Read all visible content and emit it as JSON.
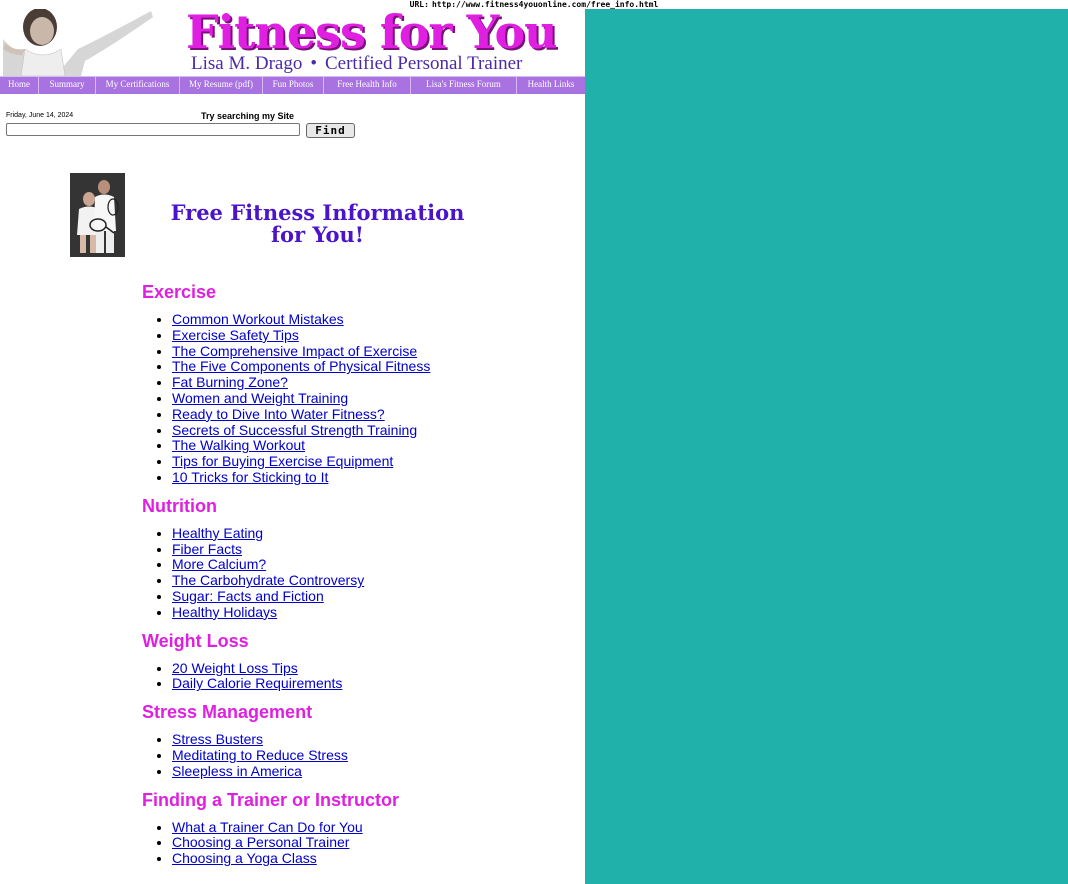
{
  "browser": {
    "url_label": "URL:",
    "url": "http://www.fitness4youonline.com/free_info.html"
  },
  "header": {
    "title": "Fitness for You",
    "subtitle_name": "Lisa M. Drago",
    "subtitle_separator": "•",
    "subtitle_role": "Certified Personal Trainer"
  },
  "nav": {
    "items": [
      {
        "label": "Home"
      },
      {
        "label": "Summary"
      },
      {
        "label": "My Certifications"
      },
      {
        "label": "My Resume (pdf)"
      },
      {
        "label": "Fun Photos"
      },
      {
        "label": "Free Health Info"
      },
      {
        "label": "Lisa's Fitness Forum"
      },
      {
        "label": "Health Links"
      }
    ]
  },
  "search": {
    "date": "Friday, June 14, 2024",
    "label": "Try searching my Site",
    "value": "",
    "button_label": "Find"
  },
  "page": {
    "heading_line1": "Free Fitness Information",
    "heading_line2": "for You!"
  },
  "sections": [
    {
      "title": "Exercise",
      "links": [
        "Common Workout Mistakes",
        "Exercise Safety Tips",
        "The Comprehensive Impact of Exercise",
        "The Five Components of Physical Fitness",
        "Fat Burning Zone?",
        "Women and Weight Training",
        "Ready to Dive Into Water Fitness?",
        "Secrets of Successful Strength Training",
        "The Walking Workout",
        "Tips for Buying Exercise Equipment",
        "10 Tricks for Sticking to It"
      ]
    },
    {
      "title": "Nutrition",
      "links": [
        "Healthy Eating",
        "Fiber Facts",
        "More Calcium?",
        "The Carbohydrate Controversy",
        "Sugar: Facts and Fiction",
        "Healthy Holidays"
      ]
    },
    {
      "title": "Weight Loss",
      "links": [
        "20 Weight Loss Tips",
        "Daily Calorie Requirements"
      ]
    },
    {
      "title": "Stress Management",
      "links": [
        "Stress Busters",
        "Meditating to Reduce Stress",
        "Sleepless in America"
      ]
    },
    {
      "title": "Finding a Trainer or Instructor",
      "links": [
        "What a Trainer Can Do for You",
        "Choosing a Personal Trainer",
        "Choosing a Yoga Class"
      ]
    }
  ],
  "colors": {
    "page_background": "#20b2aa",
    "section_title": "#e020e0",
    "nav_background": "#a872e0",
    "link": "#0000cc",
    "heading": "#4a14c8"
  }
}
